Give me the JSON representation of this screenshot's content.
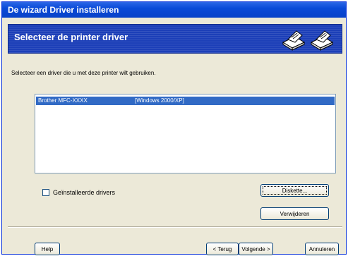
{
  "window": {
    "title": "De wizard Driver installeren"
  },
  "header": {
    "title": "Selecteer de printer driver"
  },
  "instruction": "Selecteer een driver die u met deze printer wilt gebruiken.",
  "driver_list": [
    {
      "name": "Brother  MFC-XXXX",
      "platform": "[Windows 2000/XP]",
      "selected": true
    }
  ],
  "checkbox": {
    "label": "Geïnstalleerde drivers",
    "checked": false
  },
  "buttons": {
    "diskette": "Diskette...",
    "remove": "Verwijderen",
    "help": "Help",
    "back": "< Terug",
    "next": "Volgende >",
    "cancel": "Annuleren"
  },
  "icons": [
    "printer-icon",
    "printer-icon"
  ],
  "colors": {
    "titlebar": "#0a4ad8",
    "header_bg": "#1c3fb8",
    "selection": "#316ac5",
    "dialog_bg": "#ece9d8"
  }
}
